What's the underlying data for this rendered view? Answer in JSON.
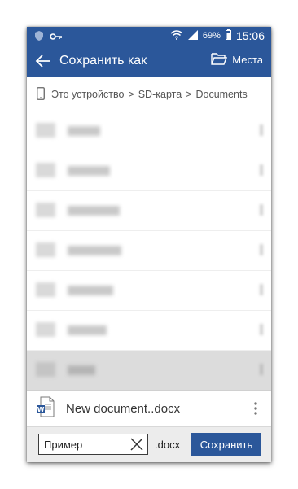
{
  "status_bar": {
    "battery_percent": "69%",
    "time": "15:06",
    "icons": [
      "shield-icon",
      "key-icon",
      "wifi-icon",
      "signal-icon",
      "battery-icon"
    ]
  },
  "app_bar": {
    "title": "Сохранить как",
    "places_label": "Места",
    "color": "#2b579a"
  },
  "breadcrumb": {
    "items": [
      "Это устройство",
      "SD-карта",
      "Documents"
    ],
    "separator": ">"
  },
  "file_list": {
    "rows": [
      {
        "name": "[blurred]"
      },
      {
        "name": "[blurred]"
      },
      {
        "name": "[blurred]"
      },
      {
        "name": "[blurred]"
      },
      {
        "name": "[blurred]"
      },
      {
        "name": "[blurred]"
      },
      {
        "name": "[blurred]",
        "selected": true
      }
    ]
  },
  "document": {
    "name": "New document..docx",
    "icon": "word-doc-icon"
  },
  "save_bar": {
    "filename_value": "Пример",
    "extension": ".docx",
    "save_label": "Сохранить"
  }
}
